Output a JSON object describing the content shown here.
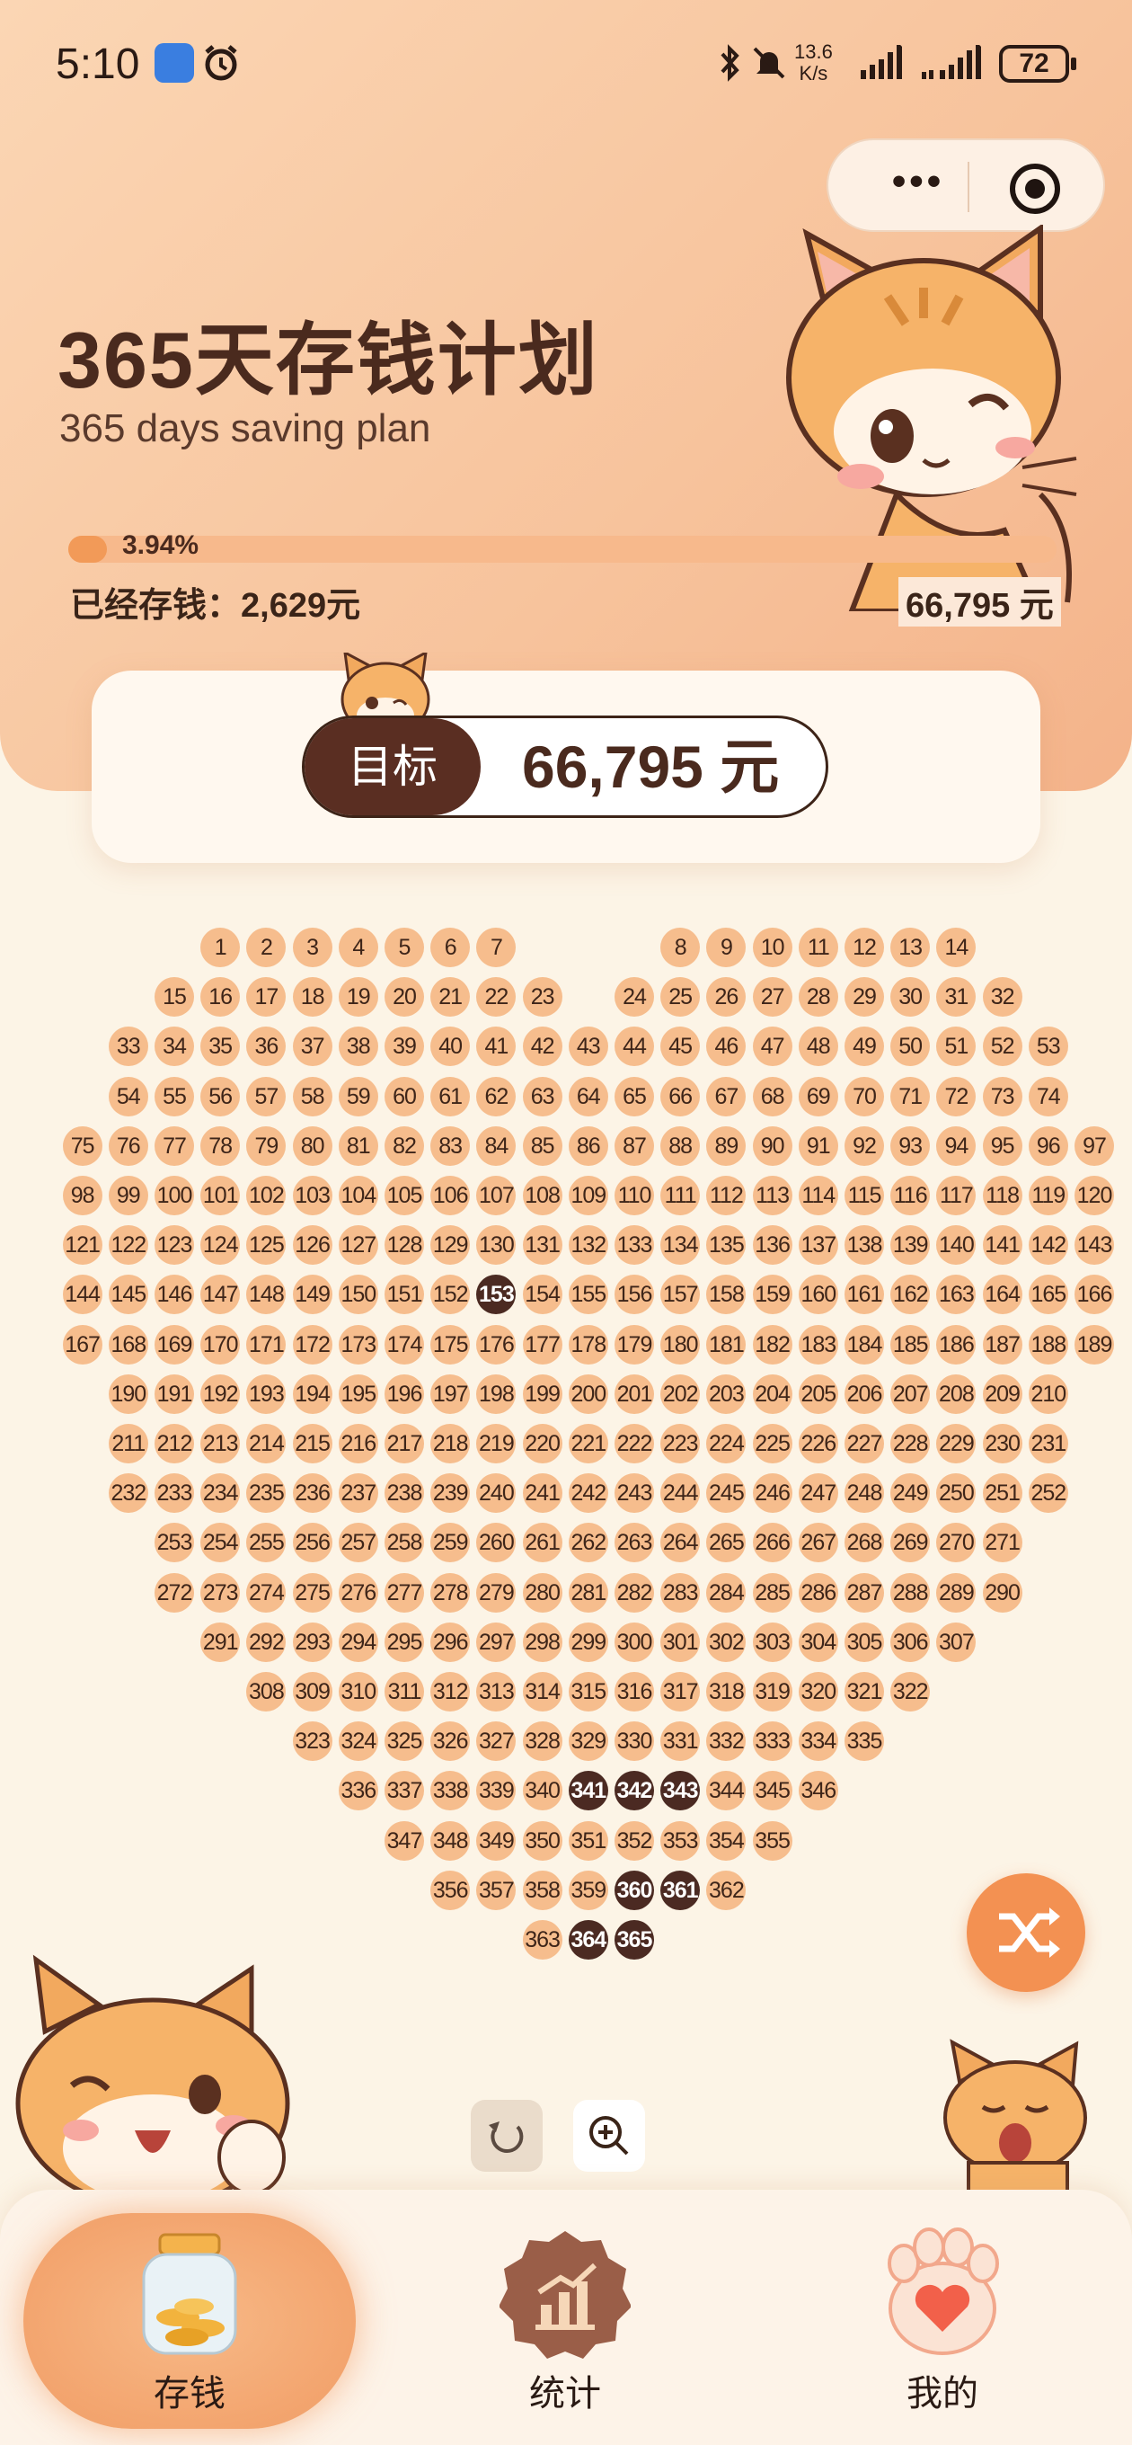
{
  "status_bar": {
    "time": "5:10",
    "net_speed": "13.6\nK/s",
    "battery": "72"
  },
  "header": {
    "title": "365天存钱计划",
    "subtitle": "365 days saving plan",
    "progress_percent_label": "3.94%",
    "progress_fraction": 0.0394,
    "saved_label": "已经存钱：2,629元",
    "goal_label": "66,795 元"
  },
  "target_card": {
    "label": "目标",
    "value": "66,795 元"
  },
  "grid": {
    "total_days": 365,
    "completed_days": [
      153,
      341,
      342,
      343,
      360,
      361,
      364,
      365
    ]
  },
  "controls": {
    "undo_icon": "undo-icon",
    "zoom_icon": "zoom-in-icon",
    "shuffle_icon": "shuffle-icon"
  },
  "tabs": [
    {
      "label": "存钱",
      "icon": "coin-jar-icon",
      "active": true
    },
    {
      "label": "统计",
      "icon": "chart-icon",
      "active": false
    },
    {
      "label": "我的",
      "icon": "paw-icon",
      "active": false
    }
  ],
  "colors": {
    "accent": "#f39152",
    "dot": "#f6bd8d",
    "dot_done": "#4b2a22",
    "brown": "#5a2e22"
  }
}
